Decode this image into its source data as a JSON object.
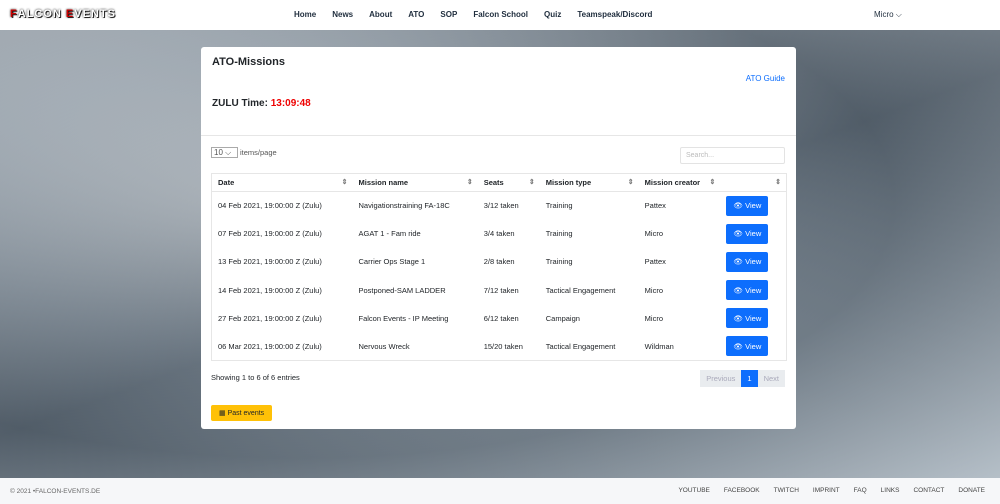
{
  "nav": {
    "logo": "FALCON EVENTS",
    "items": [
      "Home",
      "News",
      "About",
      "ATO",
      "SOP",
      "Falcon School",
      "Quiz",
      "Teamspeak/Discord"
    ],
    "user": "Micro"
  },
  "card": {
    "title": "ATO-Missions",
    "guide": "ATO Guide",
    "zulu_label": "ZULU Time:",
    "zulu_time": "13:09:48",
    "page_size": "10",
    "ipp_label": "items/page",
    "search_placeholder": "Search...",
    "headers": [
      "Date",
      "Mission name",
      "Seats",
      "Mission type",
      "Mission creator",
      ""
    ],
    "rows": [
      [
        "04 Feb 2021, 19:00:00 Z (Zulu)",
        "Navigationstraining FA-18C",
        "3/12 taken",
        "Training",
        "Pattex"
      ],
      [
        "07 Feb 2021, 19:00:00 Z (Zulu)",
        "AGAT 1 - Fam ride",
        "3/4 taken",
        "Training",
        "Micro"
      ],
      [
        "13 Feb 2021, 19:00:00 Z (Zulu)",
        "Carrier Ops Stage 1",
        "2/8 taken",
        "Training",
        "Pattex"
      ],
      [
        "14 Feb 2021, 19:00:00 Z (Zulu)",
        "Postponed-SAM LADDER",
        "7/12 taken",
        "Tactical Engagement",
        "Micro"
      ],
      [
        "27 Feb 2021, 19:00:00 Z (Zulu)",
        "Falcon Events - IP Meeting",
        "6/12 taken",
        "Campaign",
        "Micro"
      ],
      [
        "06 Mar 2021, 19:00:00 Z (Zulu)",
        "Nervous Wreck",
        "15/20 taken",
        "Tactical Engagement",
        "Wildman"
      ]
    ],
    "view_label": "View",
    "showing": "Showing 1 to 6 of 6 entries",
    "prev": "Previous",
    "page": "1",
    "next": "Next",
    "past": "Past events"
  },
  "footer": {
    "copy": "© 2021 •FALCON-EVENTS.DE",
    "links": [
      "YOUTUBE",
      "FACEBOOK",
      "TWITCH",
      "IMPRINT",
      "FAQ",
      "LINKS",
      "CONTACT",
      "DONATE"
    ]
  }
}
